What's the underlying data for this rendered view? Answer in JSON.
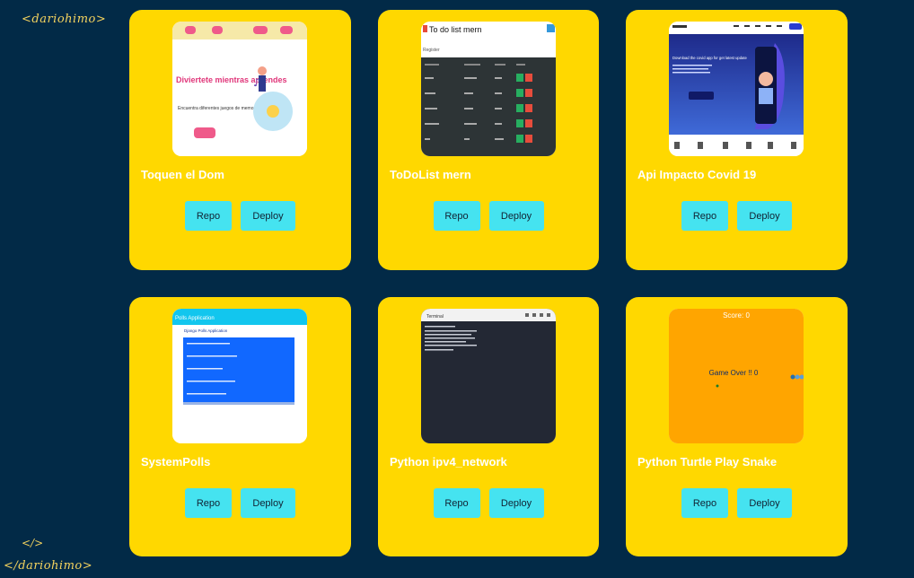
{
  "brand": {
    "open_tag": "<dariohimo>",
    "self_close": "</>",
    "close_tag": "</dariohimo>"
  },
  "projects": [
    {
      "title": "Toquen el Dom",
      "repo_label": "Repo",
      "deploy_label": "Deploy",
      "thumb": {
        "heading": "Diviertete mientras aprendes",
        "sub": "Encuentra diferentes juegos de memoria y concentración"
      }
    },
    {
      "title": "ToDoList mern",
      "repo_label": "Repo",
      "deploy_label": "Deploy",
      "thumb": {
        "heading": "To do list mern",
        "sub": "Register"
      }
    },
    {
      "title": "Api Impacto Covid 19",
      "repo_label": "Repo",
      "deploy_label": "Deploy",
      "thumb": {
        "heading": "Download the covid app for get latest update"
      }
    },
    {
      "title": "SystemPolls",
      "repo_label": "Repo",
      "deploy_label": "Deploy",
      "thumb": {
        "heading": "Polls Application",
        "sub": "Django Polls Application"
      }
    },
    {
      "title": "Python ipv4_network",
      "repo_label": "Repo",
      "deploy_label": "Deploy",
      "thumb": {
        "heading": "Terminal"
      }
    },
    {
      "title": "Python Turtle Play Snake",
      "repo_label": "Repo",
      "deploy_label": "Deploy",
      "thumb": {
        "score": "Score: 0",
        "game_over": "Game Over !! 0"
      }
    }
  ],
  "colors": {
    "background": "#022a47",
    "card": "#ffd800",
    "button": "#45e3f0",
    "logo": "#f4d35e"
  }
}
